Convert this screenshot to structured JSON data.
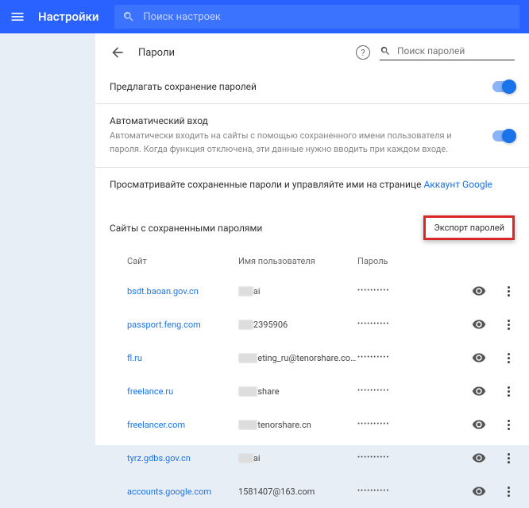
{
  "header": {
    "title": "Настройки",
    "search_placeholder": "Поиск настроек"
  },
  "page": {
    "title": "Пароли",
    "password_search_placeholder": "Поиск паролей"
  },
  "offer_save": {
    "label": "Предлагать сохранение паролей"
  },
  "auto_signin": {
    "label": "Автоматический вход",
    "desc": "Автоматически входить на сайты с помощью сохраненного имени пользователя и пароля. Когда функция отключена, эти данные нужно вводить при каждом входе."
  },
  "google_account": {
    "text": "Просматривайте сохраненные пароли и управляйте ими на странице ",
    "link": "Аккаунт Google"
  },
  "saved": {
    "title": "Сайты с сохраненными паролями",
    "export_label": "Экспорт паролей"
  },
  "columns": {
    "site": "Сайт",
    "user": "Имя пользователя",
    "pass": "Пароль"
  },
  "rows": [
    {
      "site": "bsdt.baoan.gov.cn",
      "user_blur": "xx",
      "user": "ai",
      "pass": "••••••••••"
    },
    {
      "site": "passport.feng.com",
      "user_blur": "xx",
      "user": "2395906",
      "pass": "••••••••••"
    },
    {
      "site": "fl.ru",
      "user_blur": "xxx",
      "user": "eting_ru@tenorshare.co…",
      "pass": "••••••••••"
    },
    {
      "site": "freelance.ru",
      "user_blur": "xxx",
      "user": "share",
      "pass": "••••••••••"
    },
    {
      "site": "freelancer.com",
      "user_blur": "xxx",
      "user": "tenorshare.cn",
      "pass": "••••••••••"
    },
    {
      "site": "tyrz.gdbs.gov.cn",
      "user_blur": "xx",
      "user": "ai",
      "pass": "••••••••••"
    },
    {
      "site": "accounts.google.com",
      "user_blur": "",
      "user": "1581407@163.com",
      "pass": "••••••••••"
    }
  ]
}
